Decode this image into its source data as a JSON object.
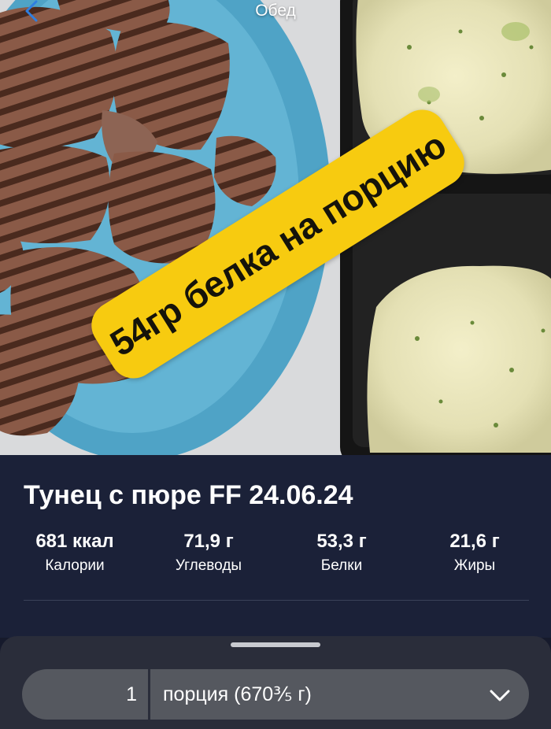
{
  "header": {
    "title": "Обед",
    "back_icon": "chevron-left-icon"
  },
  "photo": {
    "promo_text": "54гр белка на порцию",
    "promo_color": "#f7cb10"
  },
  "dish": {
    "title": "Тунец с пюре FF 24.06.24",
    "nutrients": [
      {
        "value": "681 ккал",
        "label": "Калории"
      },
      {
        "value": "71,9 г",
        "label": "Углеводы"
      },
      {
        "value": "53,3 г",
        "label": "Белки"
      },
      {
        "value": "21,6 г",
        "label": "Жиры"
      }
    ]
  },
  "portion": {
    "quantity": "1",
    "unit": "порция (670⅗ г)",
    "dropdown_icon": "chevron-down-icon"
  },
  "colors": {
    "panel_bg": "#1b2138",
    "sheet_bg": "#2a2d3a",
    "field_bg": "#55585f",
    "text": "#ffffff"
  }
}
